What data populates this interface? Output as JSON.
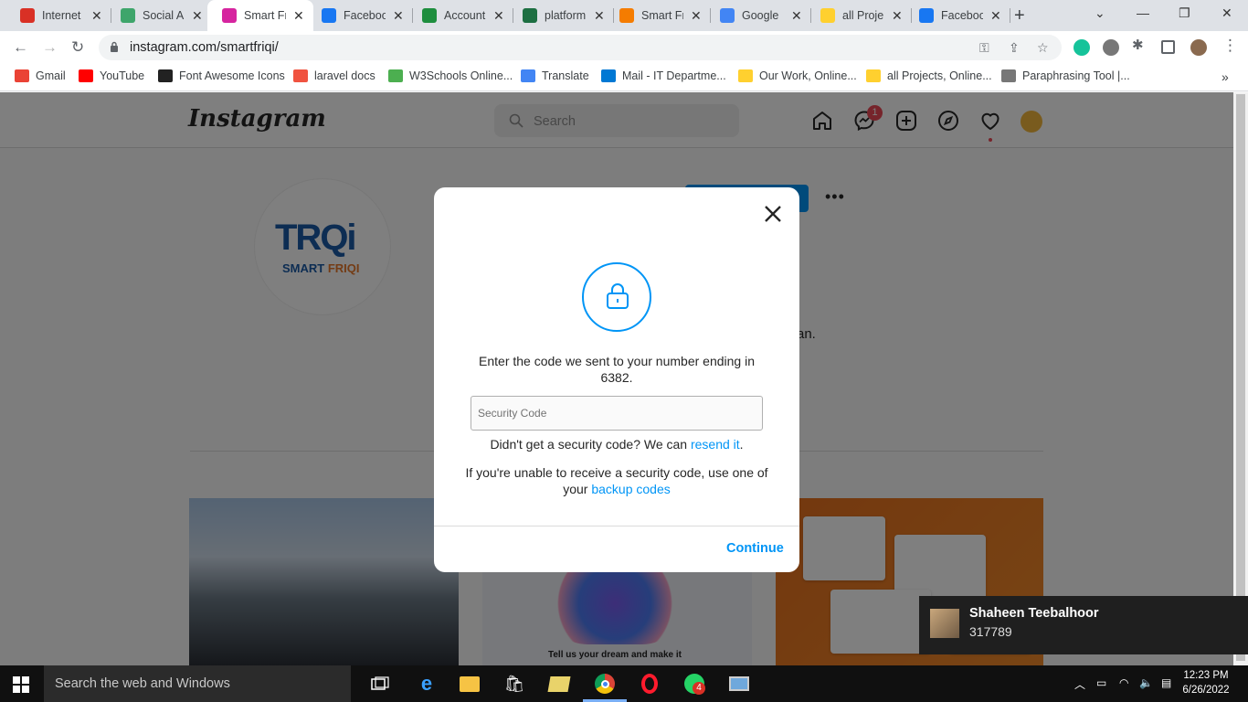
{
  "browser": {
    "tabs": [
      {
        "title": "Internet",
        "icon": "internet-icon",
        "color": "#d93025"
      },
      {
        "title": "Social A",
        "icon": "social-icon",
        "color": "#3ea56b"
      },
      {
        "title": "Smart Fr",
        "icon": "instagram-icon",
        "color": "#d6249f"
      },
      {
        "title": "Faceboo",
        "icon": "facebook-icon",
        "color": "#1877f2"
      },
      {
        "title": "Account",
        "icon": "account-icon",
        "color": "#1e8e3e"
      },
      {
        "title": "platform",
        "icon": "excel-icon",
        "color": "#1d6f42"
      },
      {
        "title": "Smart Fr",
        "icon": "search-engine-icon",
        "color": "#f57c00"
      },
      {
        "title": "Google",
        "icon": "google-translate-icon",
        "color": "#4285f4"
      },
      {
        "title": "all Proje",
        "icon": "miro-icon",
        "color": "#ffd02f"
      },
      {
        "title": "Faceboo",
        "icon": "facebook-icon",
        "color": "#1877f2"
      }
    ],
    "url": "instagram.com/smartfriqi/",
    "bookmarks": [
      {
        "label": "Gmail",
        "icon": "gmail-icon",
        "color": "#ea4335"
      },
      {
        "label": "YouTube",
        "icon": "youtube-icon",
        "color": "#ff0000"
      },
      {
        "label": "Font Awesome Icons",
        "icon": "font-awesome-icon",
        "color": "#222222"
      },
      {
        "label": "laravel docs",
        "icon": "laravel-icon",
        "color": "#f05340"
      },
      {
        "label": "W3Schools Online...",
        "icon": "w3schools-icon",
        "color": "#4caf50"
      },
      {
        "label": "Translate",
        "icon": "translate-icon",
        "color": "#4285f4"
      },
      {
        "label": "Mail - IT Departme...",
        "icon": "outlook-icon",
        "color": "#0078d4"
      },
      {
        "label": "Our Work, Online...",
        "icon": "miro-icon",
        "color": "#ffd02f"
      },
      {
        "label": "all Projects, Online...",
        "icon": "miro-icon",
        "color": "#ffd02f"
      },
      {
        "label": "Paraphrasing Tool |...",
        "icon": "quill-icon",
        "color": "#777777"
      }
    ]
  },
  "instagram": {
    "logo": "Instagram",
    "search_placeholder": "Search",
    "messages_badge": "1",
    "bio_tail": "an.",
    "profile_logo_main": "TRQi",
    "profile_logo_sub_a": "SMART ",
    "profile_logo_sub_b": "FRIQI",
    "post_caption": "Tell us your dream and make it"
  },
  "modal": {
    "message": "Enter the code we sent to your number ending in 6382.",
    "input_placeholder": "Security Code",
    "input_value": "",
    "resend_prefix": "Didn't get a security code? We can ",
    "resend_link": "resend it",
    "resend_suffix": ".",
    "backup_prefix": "If you're unable to receive a security code, use one of your ",
    "backup_link": "backup codes",
    "continue_label": "Continue",
    "accent": "#0095f6"
  },
  "notification": {
    "name": "Shaheen Teebalhoor",
    "text": "317789"
  },
  "taskbar": {
    "search_placeholder": "Search the web and Windows",
    "whatsapp_badge": "4",
    "time": "12:23 PM",
    "date": "6/26/2022"
  }
}
